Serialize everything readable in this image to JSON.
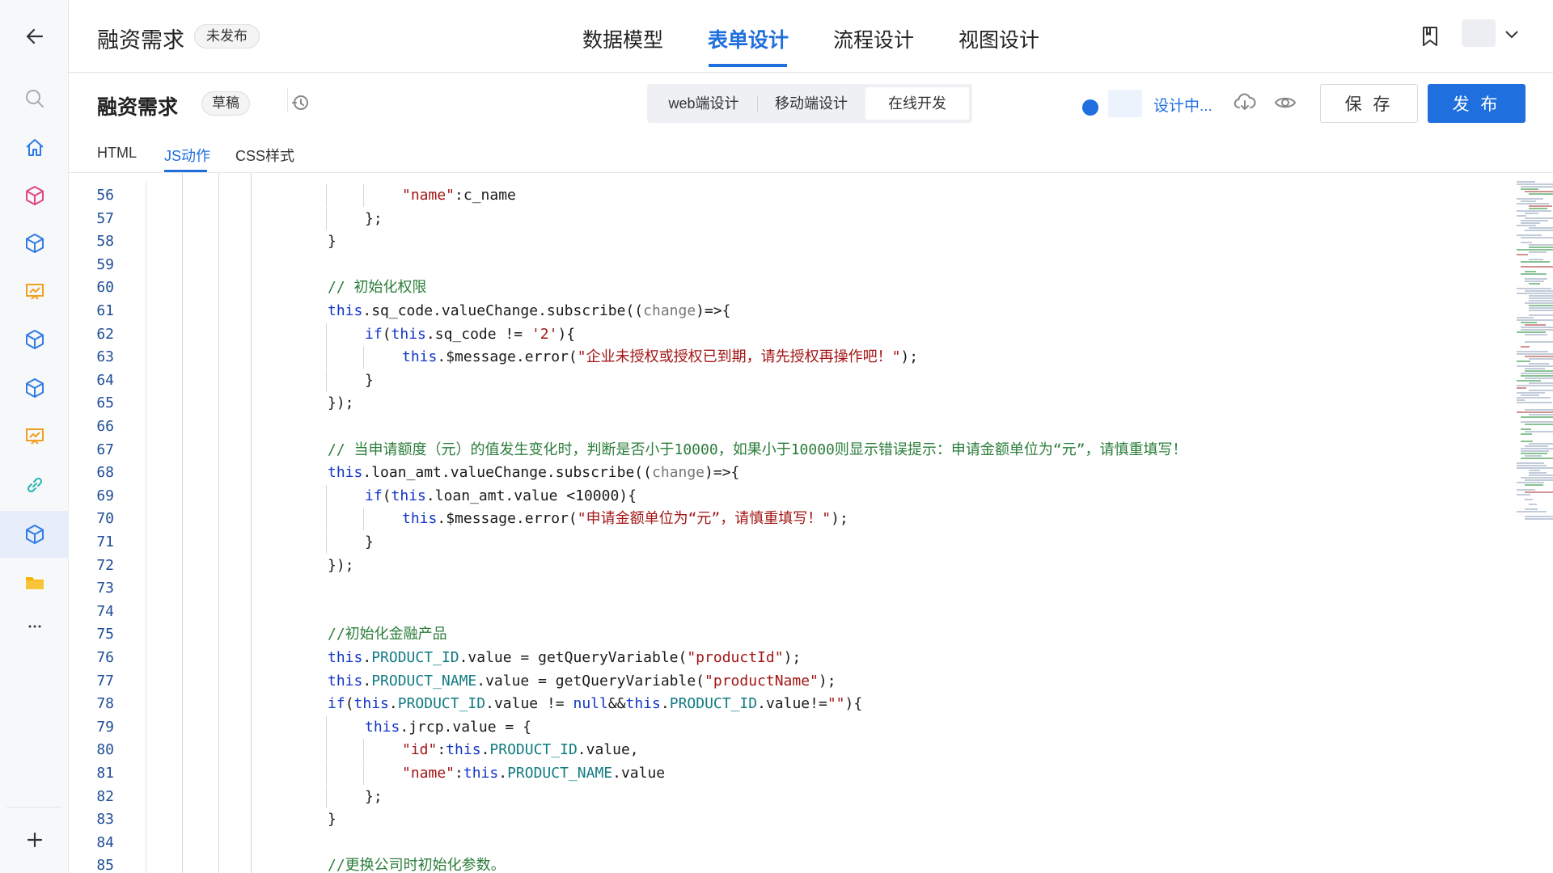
{
  "header": {
    "app_title": "融资需求",
    "status_badge": "未发布",
    "tabs": [
      {
        "label": "数据模型",
        "active": false
      },
      {
        "label": "表单设计",
        "active": true
      },
      {
        "label": "流程设计",
        "active": false
      },
      {
        "label": "视图设计",
        "active": false
      }
    ]
  },
  "toolbar": {
    "form_title": "融资需求",
    "draft_badge": "草稿",
    "modes": [
      {
        "label": "web端设计",
        "active": false
      },
      {
        "label": "移动端设计",
        "active": false
      },
      {
        "label": "在线开发",
        "active": true
      }
    ],
    "design_status": "设计中...",
    "save_label": "保 存",
    "publish_label": "发 布"
  },
  "code_tabs": [
    {
      "label": "HTML",
      "active": false
    },
    {
      "label": "JS动作",
      "active": true
    },
    {
      "label": "CSS样式",
      "active": false
    }
  ],
  "colors": {
    "accent": "#1f6fde",
    "keyword": "#1336c7",
    "string": "#a31515",
    "comment": "#2b7d3a",
    "property": "#127b82"
  },
  "icons": {
    "back": "arrow-left-icon",
    "history": "history-clock-icon",
    "bookmark": "bookmark-icon",
    "cloud": "cloud-download-icon",
    "preview": "eye-icon"
  },
  "code": {
    "lines": [
      {
        "n": "56",
        "indent": 3,
        "text": "\"name\":c_name"
      },
      {
        "n": "57",
        "indent": 2,
        "text": "};"
      },
      {
        "n": "58",
        "indent": 1,
        "text": "}"
      },
      {
        "n": "59",
        "indent": 0,
        "text": ""
      },
      {
        "n": "60",
        "indent": 1,
        "text": "// 初始化权限"
      },
      {
        "n": "61",
        "indent": 1,
        "text": "this.sq_code.valueChange.subscribe((change)=>{"
      },
      {
        "n": "62",
        "indent": 2,
        "text": "if(this.sq_code != '2'){"
      },
      {
        "n": "63",
        "indent": 3,
        "text": "this.$message.error(\"企业未授权或授权已到期，请先授权再操作吧！\");"
      },
      {
        "n": "64",
        "indent": 2,
        "text": "}"
      },
      {
        "n": "65",
        "indent": 1,
        "text": "});"
      },
      {
        "n": "66",
        "indent": 0,
        "text": ""
      },
      {
        "n": "67",
        "indent": 1,
        "text": "// 当申请额度（元）的值发生变化时，判断是否小于10000，如果小于10000则显示错误提示：申请金额单位为“元”，请慎重填写！"
      },
      {
        "n": "68",
        "indent": 1,
        "text": "this.loan_amt.valueChange.subscribe((change)=>{"
      },
      {
        "n": "69",
        "indent": 2,
        "text": "if(this.loan_amt.value <10000){"
      },
      {
        "n": "70",
        "indent": 3,
        "text": "this.$message.error(\"申请金额单位为“元”，请慎重填写！\");"
      },
      {
        "n": "71",
        "indent": 2,
        "text": "}"
      },
      {
        "n": "72",
        "indent": 1,
        "text": "});"
      },
      {
        "n": "73",
        "indent": 0,
        "text": ""
      },
      {
        "n": "74",
        "indent": 0,
        "text": ""
      },
      {
        "n": "75",
        "indent": 1,
        "text": "//初始化金融产品"
      },
      {
        "n": "76",
        "indent": 1,
        "text": "this.PRODUCT_ID.value = getQueryVariable(\"productId\");"
      },
      {
        "n": "77",
        "indent": 1,
        "text": "this.PRODUCT_NAME.value = getQueryVariable(\"productName\");"
      },
      {
        "n": "78",
        "indent": 1,
        "text": "if(this.PRODUCT_ID.value != null&&this.PRODUCT_ID.value!=\"\"){"
      },
      {
        "n": "79",
        "indent": 2,
        "text": "this.jrcp.value = {"
      },
      {
        "n": "80",
        "indent": 3,
        "text": "\"id\":this.PRODUCT_ID.value,"
      },
      {
        "n": "81",
        "indent": 3,
        "text": "\"name\":this.PRODUCT_NAME.value"
      },
      {
        "n": "82",
        "indent": 2,
        "text": "};"
      },
      {
        "n": "83",
        "indent": 1,
        "text": "}"
      },
      {
        "n": "84",
        "indent": 0,
        "text": ""
      },
      {
        "n": "85",
        "indent": 1,
        "text": "//更换公司时初始化参数。"
      }
    ]
  }
}
